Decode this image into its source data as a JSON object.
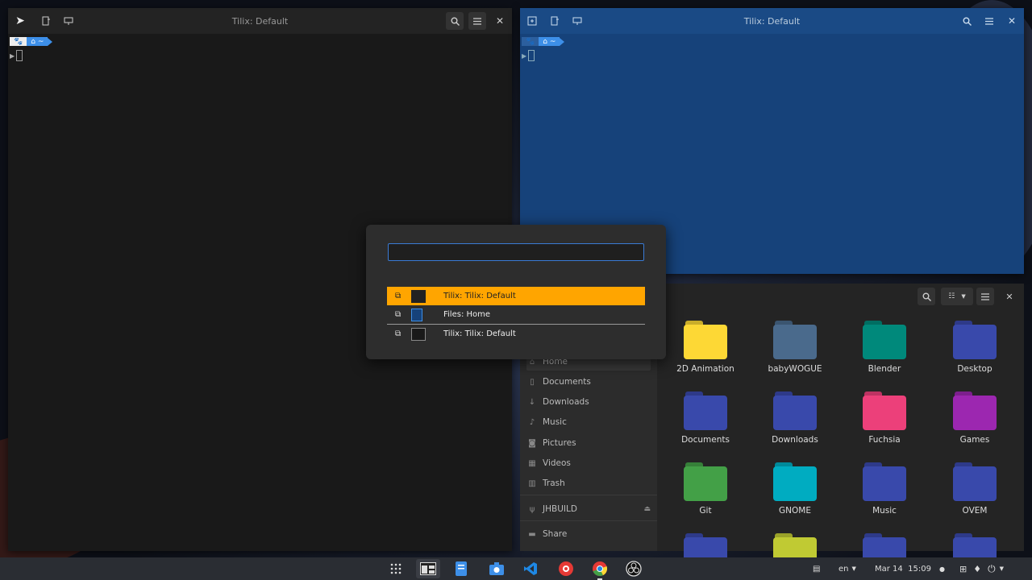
{
  "terminal_left": {
    "title": "Tilix: Default",
    "prompt_home_glyph": "~"
  },
  "terminal_right": {
    "title": "Tilix: Default",
    "prompt_home_glyph": "~"
  },
  "switcher": {
    "search_value": "",
    "items": [
      {
        "label": "Tilix: Tilix: Default",
        "selected": true
      },
      {
        "label": "Files: Home",
        "selected": false
      },
      {
        "label": "Tilix: Tilix: Default",
        "selected": false
      }
    ]
  },
  "files": {
    "sidebar": [
      {
        "label": "Home",
        "icon": "home-icon"
      },
      {
        "label": "Documents",
        "icon": "document-icon"
      },
      {
        "label": "Downloads",
        "icon": "download-icon"
      },
      {
        "label": "Music",
        "icon": "music-icon"
      },
      {
        "label": "Pictures",
        "icon": "camera-icon"
      },
      {
        "label": "Videos",
        "icon": "video-icon"
      },
      {
        "label": "Trash",
        "icon": "trash-icon"
      },
      {
        "label": "JHBUILD",
        "icon": "usb-icon"
      },
      {
        "label": "Share",
        "icon": "folder-icon"
      }
    ],
    "folders": [
      {
        "label": "2D Animation",
        "color": "#fdd835"
      },
      {
        "label": "babyWOGUE",
        "color": "#4a6a8c"
      },
      {
        "label": "Blender",
        "color": "#00897b"
      },
      {
        "label": "Desktop",
        "color": "#3949ab"
      },
      {
        "label": "Documents",
        "color": "#3949ab"
      },
      {
        "label": "Downloads",
        "color": "#3949ab"
      },
      {
        "label": "Fuchsia",
        "color": "#ec407a"
      },
      {
        "label": "Games",
        "color": "#9c27b0"
      },
      {
        "label": "Git",
        "color": "#43a047"
      },
      {
        "label": "GNOME",
        "color": "#00acc1"
      },
      {
        "label": "Music",
        "color": "#3949ab"
      },
      {
        "label": "OVEM",
        "color": "#3949ab"
      },
      {
        "label": "",
        "color": "#3949ab"
      },
      {
        "label": "",
        "color": "#c0ca33"
      },
      {
        "label": "",
        "color": "#3949ab"
      },
      {
        "label": "",
        "color": "#3949ab"
      }
    ]
  },
  "taskbar": {
    "language": "en",
    "clock": "Mar 14  15:09"
  },
  "colors": {
    "selection": "#ffa500",
    "right_terminal_bg": "#16427a",
    "accent_blue": "#3d8fe8"
  }
}
